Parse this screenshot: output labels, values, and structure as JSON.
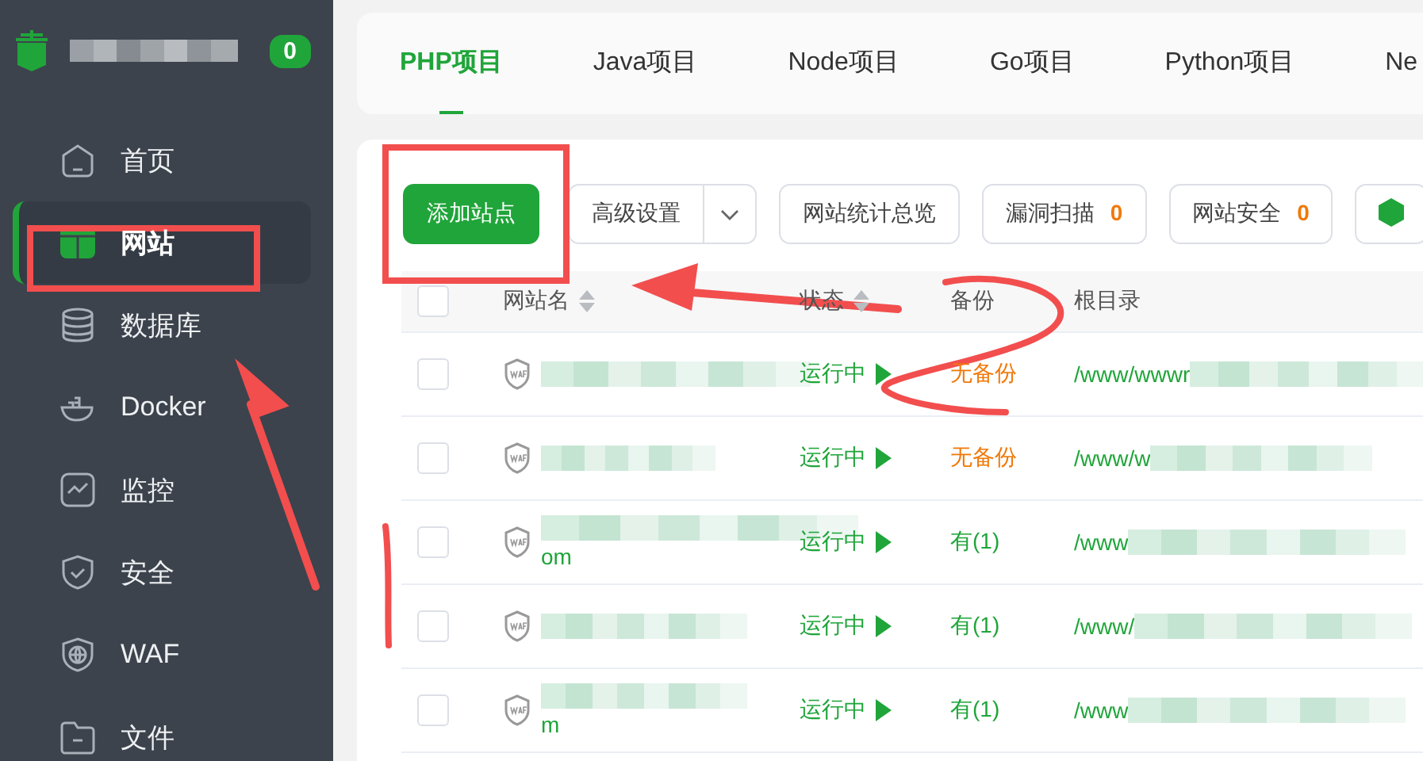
{
  "sidebar": {
    "badge": "0",
    "items": [
      {
        "label": "首页",
        "selected": false
      },
      {
        "label": "网站",
        "selected": true
      },
      {
        "label": "数据库",
        "selected": false
      },
      {
        "label": "Docker",
        "selected": false
      },
      {
        "label": "监控",
        "selected": false
      },
      {
        "label": "安全",
        "selected": false
      },
      {
        "label": "WAF",
        "selected": false
      },
      {
        "label": "文件",
        "selected": false
      }
    ]
  },
  "tabs": [
    {
      "label": "PHP项目",
      "selected": true
    },
    {
      "label": "Java项目",
      "selected": false
    },
    {
      "label": "Node项目",
      "selected": false
    },
    {
      "label": "Go项目",
      "selected": false
    },
    {
      "label": "Python项目",
      "selected": false
    },
    {
      "label": "Ne",
      "selected": false
    }
  ],
  "toolbar": [
    {
      "kind": "primary",
      "label": "添加站点"
    },
    {
      "kind": "split",
      "label": "高级设置"
    },
    {
      "kind": "plain",
      "label": "网站统计总览"
    },
    {
      "kind": "count",
      "label": "漏洞扫描",
      "count": "0"
    },
    {
      "kind": "count",
      "label": "网站安全",
      "count": "0"
    },
    {
      "kind": "icon"
    }
  ],
  "table": {
    "all_checked": false,
    "columns": [
      {
        "label": "网站名",
        "sortable": true
      },
      {
        "label": "状态",
        "sortable": true
      },
      {
        "label": "备份",
        "sortable": false
      },
      {
        "label": "根目录",
        "sortable": false
      }
    ],
    "rows": [
      {
        "checked": false,
        "status": "运行中",
        "backup": "无备份",
        "has_backup": false,
        "path": "/www/wwwr"
      },
      {
        "checked": false,
        "status": "运行中",
        "backup": "无备份",
        "has_backup": false,
        "path": "/www/w"
      },
      {
        "checked": false,
        "name_tail": "om",
        "status": "运行中",
        "backup": "有(1)",
        "has_backup": true,
        "path": "/www"
      },
      {
        "checked": false,
        "status": "运行中",
        "backup": "有(1)",
        "has_backup": true,
        "path": "/www/"
      },
      {
        "checked": false,
        "name_tail": "m",
        "status": "运行中",
        "backup": "有(1)",
        "has_backup": true,
        "path": "/www"
      }
    ]
  }
}
